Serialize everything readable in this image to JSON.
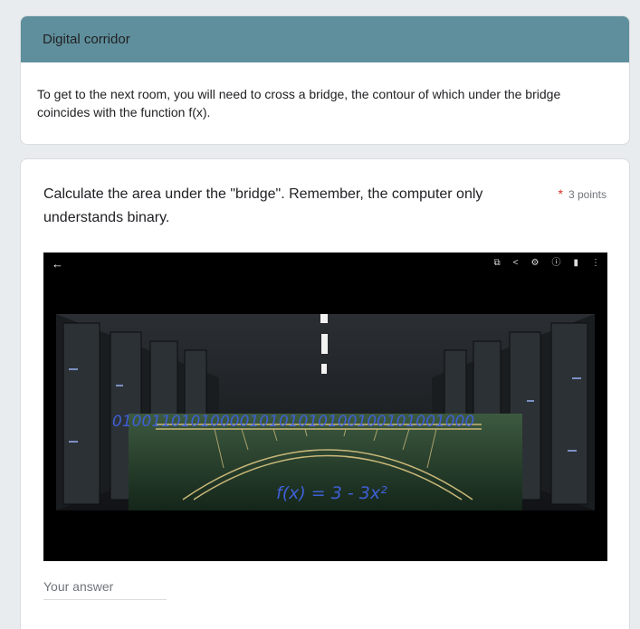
{
  "section": {
    "title": "Digital corridor",
    "description": "To get to the next room, you will need to cross a bridge, the contour of which under the bridge coincides with the function f(x)."
  },
  "question": {
    "text": "Calculate the area under the \"bridge\". Remember, the computer only understands binary.",
    "required_mark": "*",
    "points": "3 points",
    "answer_placeholder": "Your answer"
  },
  "image": {
    "binary_text": "0100110101000010101010100100101001000",
    "formula": "f(x) = 3 - 3x²",
    "toolbar_icons": [
      "back-arrow-icon",
      "cast-icon",
      "share-icon",
      "settings-icon",
      "info-icon",
      "delete-icon",
      "more-vert-icon"
    ]
  },
  "colors": {
    "header": "#5f8f9c",
    "required": "#d93025",
    "handwriting": "#3f5fd6"
  }
}
